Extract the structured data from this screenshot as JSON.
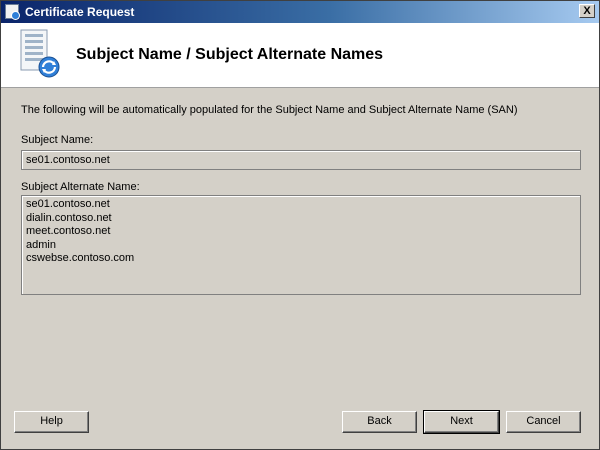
{
  "window": {
    "title": "Certificate Request",
    "close_symbol": "X"
  },
  "header": {
    "title": "Subject Name / Subject Alternate Names",
    "icon": "certificate-request-icon"
  },
  "body": {
    "description": "The following will be automatically populated for the Subject Name and Subject Alternate Name (SAN)",
    "subject_name": {
      "label": "Subject Name:",
      "value": "se01.contoso.net"
    },
    "san": {
      "label": "Subject Alternate Name:",
      "values": [
        "se01.contoso.net",
        "dialin.contoso.net",
        "meet.contoso.net",
        "admin",
        "cswebse.contoso.com"
      ]
    }
  },
  "buttons": {
    "help": "Help",
    "back": "Back",
    "next": "Next",
    "cancel": "Cancel"
  },
  "colors": {
    "dialog_face": "#d4d0c8",
    "title_bar": "#0a246a",
    "header_background": "#ffffff"
  }
}
